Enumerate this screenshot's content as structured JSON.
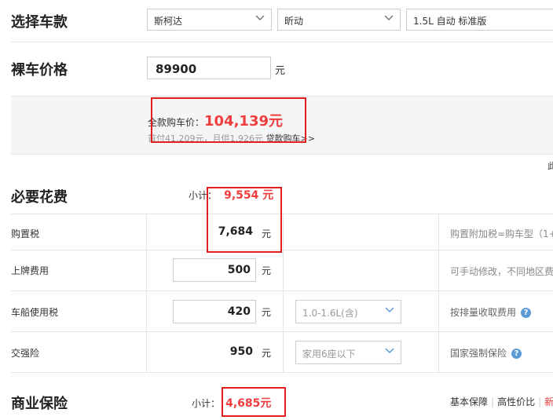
{
  "select_car": {
    "title": "选择车款",
    "brand": "斯柯达",
    "model": "昕动",
    "version": "1.5L 自动 标准版"
  },
  "bare_price": {
    "title": "裸车价格",
    "value": "89900",
    "unit": "元"
  },
  "summary": {
    "total_label": "全款购车价：",
    "total_value": "104,139元",
    "loan_info": "首付41,209元，月供1,926元",
    "loan_link": "贷款购车",
    "loan_arrows": ">>",
    "cut_text": "此"
  },
  "required": {
    "title": "必要花费",
    "subtotal_label": "小计：",
    "subtotal_value": "9,554 元",
    "rows": [
      {
        "label": "购置税",
        "value": "7,684",
        "unit": "元",
        "note": "购置附加税=购车型（1+"
      },
      {
        "label": "上牌费用",
        "value": "500",
        "unit": "元",
        "note": "可手动修改，不同地区费"
      },
      {
        "label": "车船使用税",
        "value": "420",
        "unit": "元",
        "select": "1.0-1.6L(含)",
        "note": "按排量收取费用"
      },
      {
        "label": "交强险",
        "value": "950",
        "unit": "元",
        "select": "家用6座以下",
        "note": "国家强制保险"
      }
    ],
    "help_glyph": "?"
  },
  "commercial": {
    "title": "商业保险",
    "subtotal_label": "小计：",
    "subtotal_value": "4,685元",
    "tabs": [
      "基本保障",
      "高性价比",
      "新"
    ]
  },
  "colors": {
    "accent_red": "#f03c3c",
    "highlight_border": "#e02020",
    "help_blue": "#5b9bd5"
  }
}
